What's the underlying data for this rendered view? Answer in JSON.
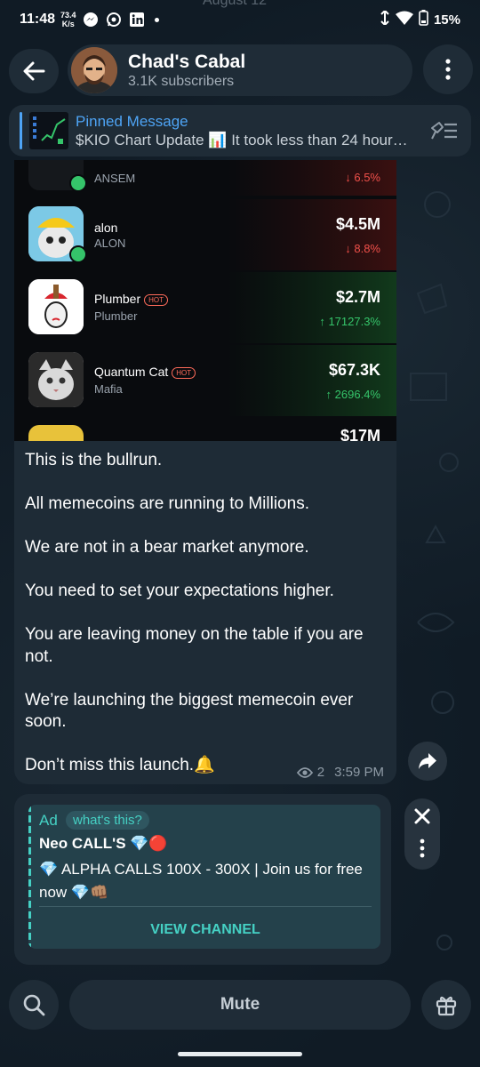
{
  "status_bar": {
    "time": "11:48",
    "net_speed_value": "73.4",
    "net_speed_unit": "K/s",
    "battery": "15%",
    "icons": [
      "messenger-icon",
      "whatsapp-icon",
      "linkedin-icon",
      "wifi-icon",
      "signal-icon",
      "battery-icon"
    ]
  },
  "ghost_date": "August 12",
  "header": {
    "title": "Chad's Cabal",
    "subtitle": "3.1K subscribers"
  },
  "pinned": {
    "label": "Pinned Message",
    "text": "$KIO Chart Update 📊 It took less than 24 hour…"
  },
  "chart_screenshot": {
    "partial_top_change": "6.5%",
    "partial_top_ticker": "ANSEM",
    "tokens": [
      {
        "name": "alon",
        "ticker": "ALON",
        "hot": false,
        "market_cap": "$4.5M",
        "change": "8.8%",
        "direction": "down"
      },
      {
        "name": "Plumber",
        "ticker": "Plumber",
        "hot": true,
        "market_cap": "$2.7M",
        "change": "17127.3%",
        "direction": "up"
      },
      {
        "name": "Quantum Cat",
        "ticker": "Mafia",
        "hot": true,
        "market_cap": "$67.3K",
        "change": "2696.4%",
        "direction": "up"
      }
    ],
    "hot_label": "HOT",
    "partial_bottom_cap": "$17M",
    "colors": {
      "up": "#35c46a",
      "down": "#f0504a"
    }
  },
  "message": {
    "paragraphs": [
      "This is the bullrun.",
      "All memecoins are running to Millions.",
      "We are not in a bear market anymore.",
      "You need to set your expectations higher.",
      "You are leaving money on the table if you are not.",
      "We’re launching the biggest memecoin ever soon.",
      "Don’t miss this launch.🔔"
    ],
    "views": "2",
    "time": "3:59 PM"
  },
  "ad": {
    "label": "Ad",
    "whats_this": "what's this?",
    "title": "Neo CALL'S 💎🔴",
    "description": "💎 ALPHA CALLS 100X - 300X | Join us for free now 💎👊🏽",
    "cta": "VIEW CHANNEL"
  },
  "bottom": {
    "mute_label": "Mute"
  },
  "accent_colors": {
    "link_blue": "#4ea4f5",
    "ad_teal": "#45d1c4",
    "bubble_bg": "#1e2b36"
  }
}
